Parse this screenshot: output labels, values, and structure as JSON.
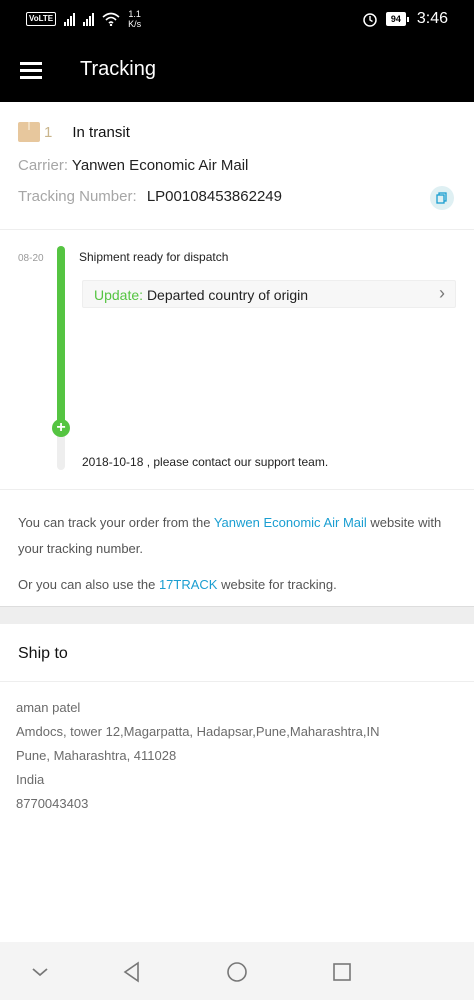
{
  "status_bar": {
    "volte": "VoLTE",
    "speed_value": "1.1",
    "speed_unit": "K/s",
    "battery": "94",
    "time": "3:46",
    "icons": [
      "signal-icon",
      "signal-icon",
      "wifi-icon",
      "alarm-icon",
      "battery-icon"
    ]
  },
  "app_bar": {
    "title": "Tracking",
    "menu_icon": "hamburger-menu-icon"
  },
  "summary": {
    "package_count": "1",
    "status": "In transit",
    "carrier_label": "Carrier:",
    "carrier": "Yanwen Economic Air Mail",
    "tracking_label": "Tracking Number:",
    "tracking_number": "LP00108453862249",
    "copy_icon": "copy-icon"
  },
  "timeline": {
    "date": "08-20",
    "event": "Shipment ready for dispatch",
    "update_label": "Update:",
    "update_text": "Departed country of origin",
    "footer": "2018-10-18 , please contact our support team.",
    "colors": {
      "accent": "#55c441"
    }
  },
  "info": {
    "line1_prefix": "You can track your order from the",
    "line1_link": "Yanwen Economic Air Mail",
    "line1_suffix": "website with your tracking number.",
    "line2_prefix": "Or you can also use the",
    "line2_link": "17TRACK",
    "line2_suffix": "website for tracking.",
    "link_color": "#1a9ed1"
  },
  "ship_to": {
    "title": "Ship to",
    "name": "aman patel",
    "address_line1": "Amdocs, tower 12,Magarpatta, Hadapsar,Pune,Maharashtra,IN",
    "address_line2": "Pune, Maharashtra, 411028",
    "country": "India",
    "phone": "8770043403"
  },
  "nav_bar": {
    "icons": [
      "chevron-down-icon",
      "back-icon",
      "home-icon",
      "recents-icon"
    ]
  }
}
